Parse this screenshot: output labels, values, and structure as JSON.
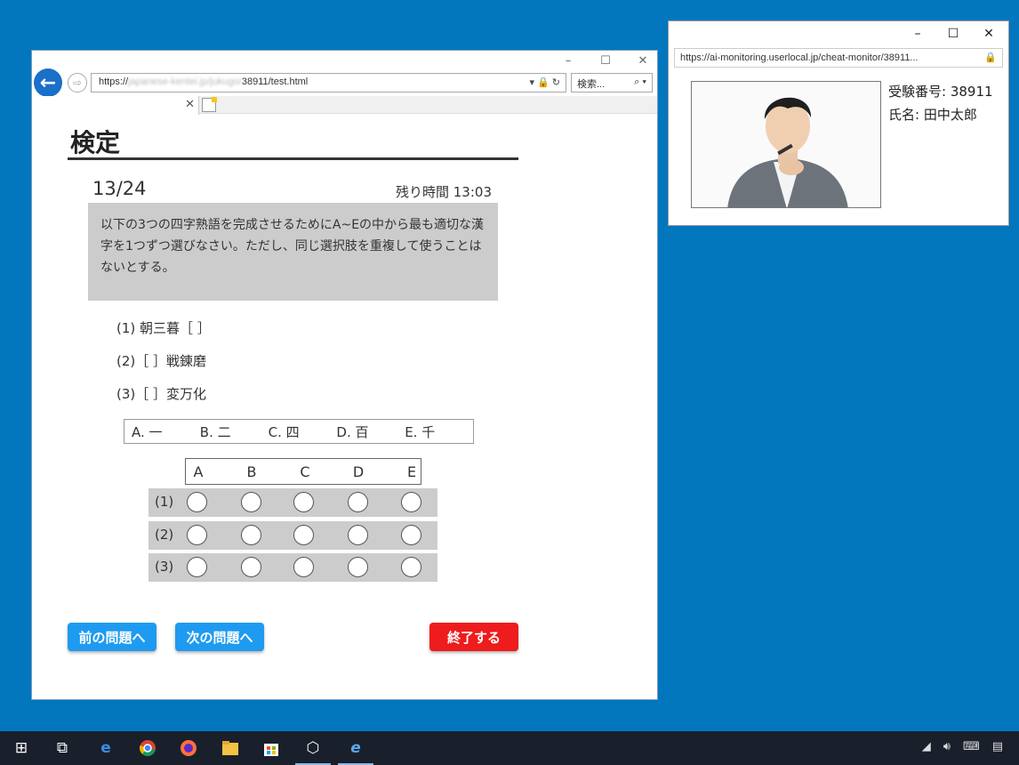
{
  "browser": {
    "url_prefix": "https://",
    "url_host_blurred": "japanese-kentei.jp/jukugo/",
    "url_rest": "38911/test.html",
    "search_placeholder": "検索...",
    "win_min": "–",
    "win_max": "☐",
    "win_close": "✕"
  },
  "page": {
    "title": "検定",
    "question_number": "13/24",
    "timer": "残り時間 13:03",
    "question_text": "以下の3つの四字熟語を完成させるためにA~Eの中から最も適切な漢字を1つずつ選びなさい。ただし、同じ選択肢を重複して使うことはないとする。",
    "items": [
      "(1) 朝三暮［ ］",
      "(2)［ ］戦錬磨",
      "(3)［ ］変万化"
    ],
    "choices": [
      "A. 一",
      "B. 二",
      "C. 四",
      "D. 百",
      "E. 千"
    ],
    "grid_columns": [
      "A",
      "B",
      "C",
      "D",
      "E"
    ],
    "grid_rows": [
      "(1)",
      "(2)",
      "(3)"
    ],
    "buttons": {
      "prev": "前の問題へ",
      "next": "次の問題へ",
      "finish": "終了する"
    }
  },
  "monitor": {
    "url": "https://ai-monitoring.userlocal.jp/cheat-monitor/38911...",
    "exam_id_label": "受験番号: 38911",
    "name_label": "氏名: 田中太郎"
  },
  "colors": {
    "desktop": "#0277bd",
    "button_blue": "#1e9bf0",
    "button_red": "#ee1c1c",
    "question_bg": "#cccccc"
  }
}
